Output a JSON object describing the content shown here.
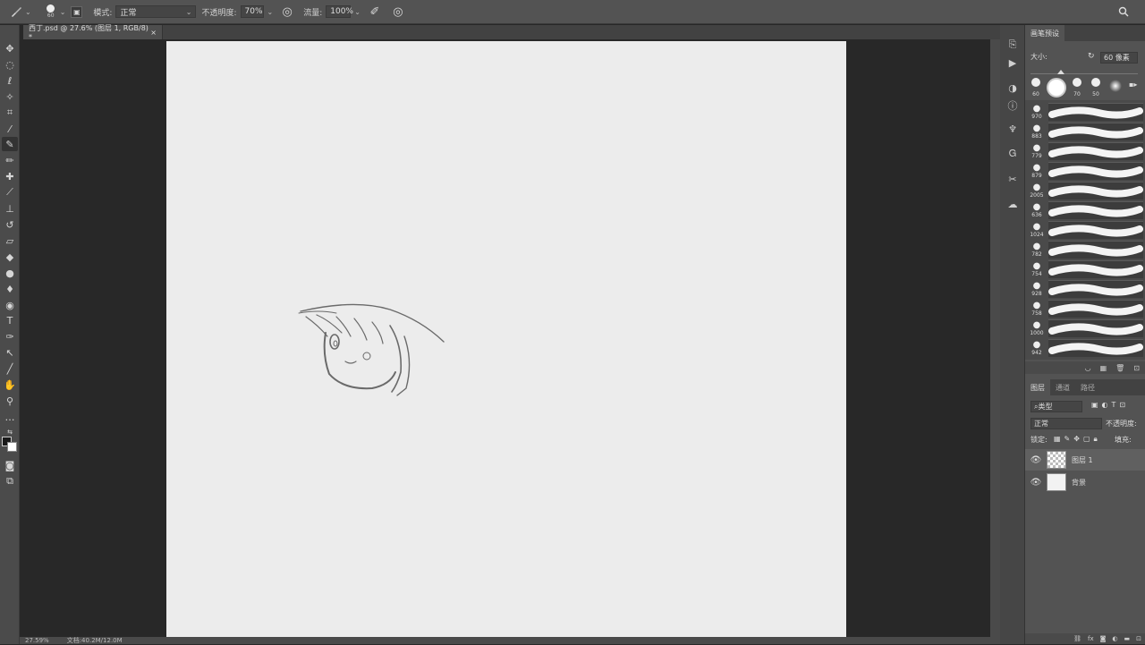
{
  "options_bar": {
    "brush_size": "60",
    "mode_label": "模式:",
    "mode_value": "正常",
    "opacity_label": "不透明度:",
    "opacity_value": "70%",
    "flow_label": "流量:",
    "flow_value": "100%"
  },
  "document_tab": {
    "title": "西丁.psd @ 27.6% (图层 1, RGB/8) *",
    "close": "×"
  },
  "status_bar": {
    "zoom": "27.59%",
    "doc_info": "文档:40.2M/12.0M"
  },
  "brush_panel": {
    "title": "画笔预设",
    "size_label": "大小:",
    "size_value": "60 像素",
    "preset_tips": [
      {
        "label": "60"
      },
      {
        "label": ""
      },
      {
        "label": "70"
      },
      {
        "label": "50"
      },
      {
        "label": ""
      }
    ],
    "brushes": [
      {
        "size": "970"
      },
      {
        "size": "883"
      },
      {
        "size": "779"
      },
      {
        "size": "879"
      },
      {
        "size": "2005"
      },
      {
        "size": "636"
      },
      {
        "size": "1024"
      },
      {
        "size": "782"
      },
      {
        "size": "754"
      },
      {
        "size": "928"
      },
      {
        "size": "758"
      },
      {
        "size": "1000"
      },
      {
        "size": "942"
      }
    ]
  },
  "layers_panel": {
    "tabs": [
      "图层",
      "通道",
      "路径"
    ],
    "filter_label": "类型",
    "blend_mode": "正常",
    "opacity_label": "不透明度:",
    "lock_label": "锁定:",
    "fill_label": "填充:",
    "layers": [
      {
        "name": "图层 1",
        "type": "transparent"
      },
      {
        "name": "背景",
        "type": "white"
      }
    ]
  },
  "icons": {
    "brush_tool": "brush-icon",
    "move_tool": "move-icon",
    "marquee_tool": "marquee-icon",
    "lasso_tool": "lasso-icon",
    "eye": "eye-icon"
  },
  "colors": {
    "canvas": "#ececec",
    "workspace": "#282828",
    "panel": "#535353"
  }
}
